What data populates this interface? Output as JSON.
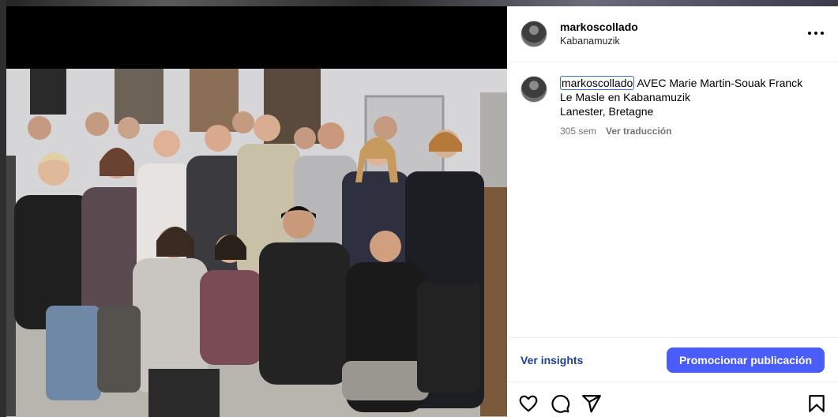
{
  "post": {
    "username": "markoscollado",
    "subtitle": "Kabanamuzik"
  },
  "caption": {
    "username": "markoscollado",
    "text_line1": " AVEC Marie Martin-Souak Franck",
    "text_line2": "Le Masle en Kabanamuzik",
    "text_line3": "Lanester, Bretagne",
    "age": "305 sem",
    "translate_label": "Ver traducción"
  },
  "actions": {
    "insights_label": "Ver insights",
    "promote_label": "Promocionar publicación"
  },
  "icons": [
    "more-icon",
    "heart-icon",
    "comment-icon",
    "share-icon",
    "bookmark-icon"
  ],
  "colors": {
    "promote_bg": "#4a5df9",
    "insights_text": "#1e3f8a",
    "mention_outline": "#2f6fd6"
  }
}
